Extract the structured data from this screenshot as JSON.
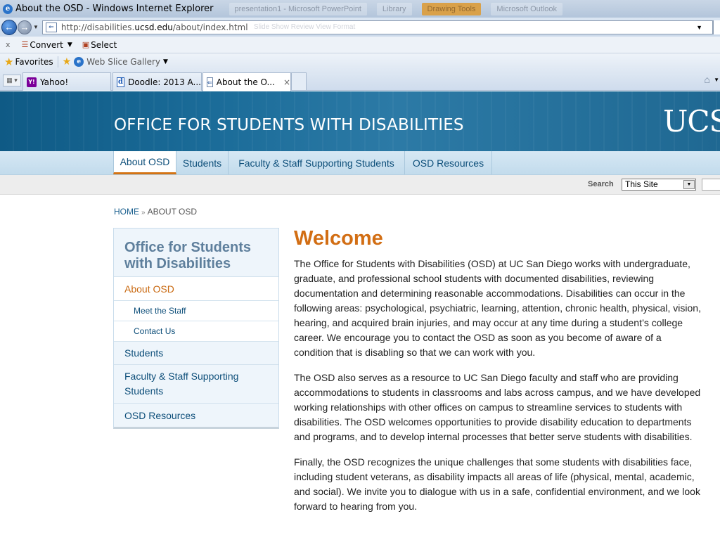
{
  "browser": {
    "window_title": "About the OSD - Windows Internet Explorer",
    "ie_icon": "internet-explorer-icon",
    "background_windows": [
      "presentation1 - Microsoft PowerPoint",
      "Library",
      "Drawing Tools",
      "Microsoft Outlook"
    ],
    "address_prefix": "http://disabilities.",
    "address_domain": "ucsd.edu",
    "address_suffix": "/about/index.html",
    "address_ghost": "Slide Show   Review   View   Format",
    "command_close": "x",
    "convert_label": "Convert",
    "select_label": "Select",
    "favorites_label": "Favorites",
    "web_slice_label": "Web Slice Gallery",
    "tabs": [
      {
        "label": "Yahoo!",
        "icon": "Y!"
      },
      {
        "label": "Doodle: 2013 A...",
        "icon": "d"
      },
      {
        "label": "About the O...",
        "icon": "⇐"
      }
    ],
    "tab_close": "×"
  },
  "site": {
    "title": "OFFICE FOR STUDENTS WITH DISABILITIES",
    "logo_text": "UCS",
    "nav": [
      "About OSD",
      "Students",
      "Faculty & Staff Supporting Students",
      "OSD Resources"
    ],
    "search": {
      "label": "Search",
      "scope": "This Site"
    },
    "breadcrumb": {
      "home": "HOME",
      "sep": "»",
      "current": "ABOUT OSD"
    }
  },
  "sidebar": {
    "heading": "Office for Students with Disabilities",
    "items": [
      {
        "label": "About OSD"
      },
      {
        "label": "Meet the Staff"
      },
      {
        "label": "Contact Us"
      },
      {
        "label": "Students"
      },
      {
        "label": "Faculty & Staff Supporting Students"
      },
      {
        "label": "OSD Resources"
      }
    ]
  },
  "main": {
    "heading": "Welcome",
    "paragraphs": [
      "The Office for Students with Disabilities (OSD) at UC San Diego works with undergraduate, graduate, and professional school students with documented disabilities, reviewing documentation and determining reasonable accommodations. Disabilities can occur in the following areas: psychological, psychiatric, learning, attention, chronic health, physical, vision, hearing, and acquired brain injuries, and may occur at any time during a student’s college career.  We encourage you to contact the OSD as soon as you become of aware of a condition that is disabling so that we can work with you.",
      "The OSD also serves as a resource to UC San Diego faculty and staff who are providing accommodations to students in classrooms and labs across campus, and we have developed working relationships with other offices on campus to streamline services to students with disabilities.  The OSD welcomes opportunities to provide disability education to departments and programs, and to develop internal processes that better serve students with disabilities.",
      "Finally, the OSD recognizes the unique challenges that some students with disabilities face, including student veterans, as disability impacts all areas of life (physical, mental, academic, and social).  We invite you to dialogue with us in a safe, confidential environment, and we look forward to hearing from you."
    ]
  }
}
